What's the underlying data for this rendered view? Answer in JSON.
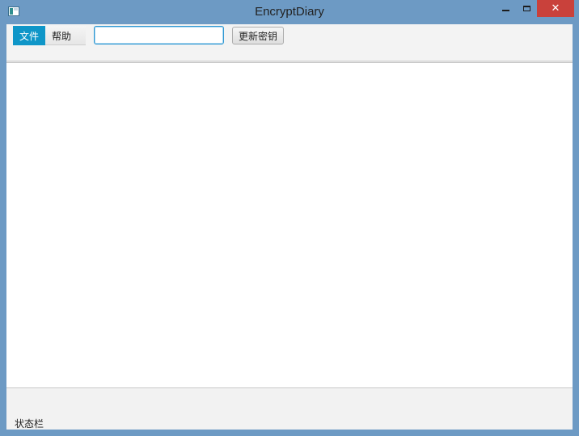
{
  "window": {
    "title": "EncryptDiary",
    "icon": "app-icon",
    "controls": {
      "minimize": "minimize-icon",
      "maximize": "maximize-icon",
      "close": "close-icon",
      "close_color": "#c9413b"
    },
    "frame_color": "#6d9ac4"
  },
  "menu": {
    "items": [
      {
        "label": "文件",
        "active": true
      },
      {
        "label": "帮助",
        "active": false
      }
    ],
    "active_color": "#0f96c8"
  },
  "toolbar": {
    "key_input": {
      "value": "",
      "placeholder": ""
    },
    "update_key_label": "更新密钥"
  },
  "editor": {
    "content": ""
  },
  "statusbar": {
    "text": "状态栏"
  }
}
